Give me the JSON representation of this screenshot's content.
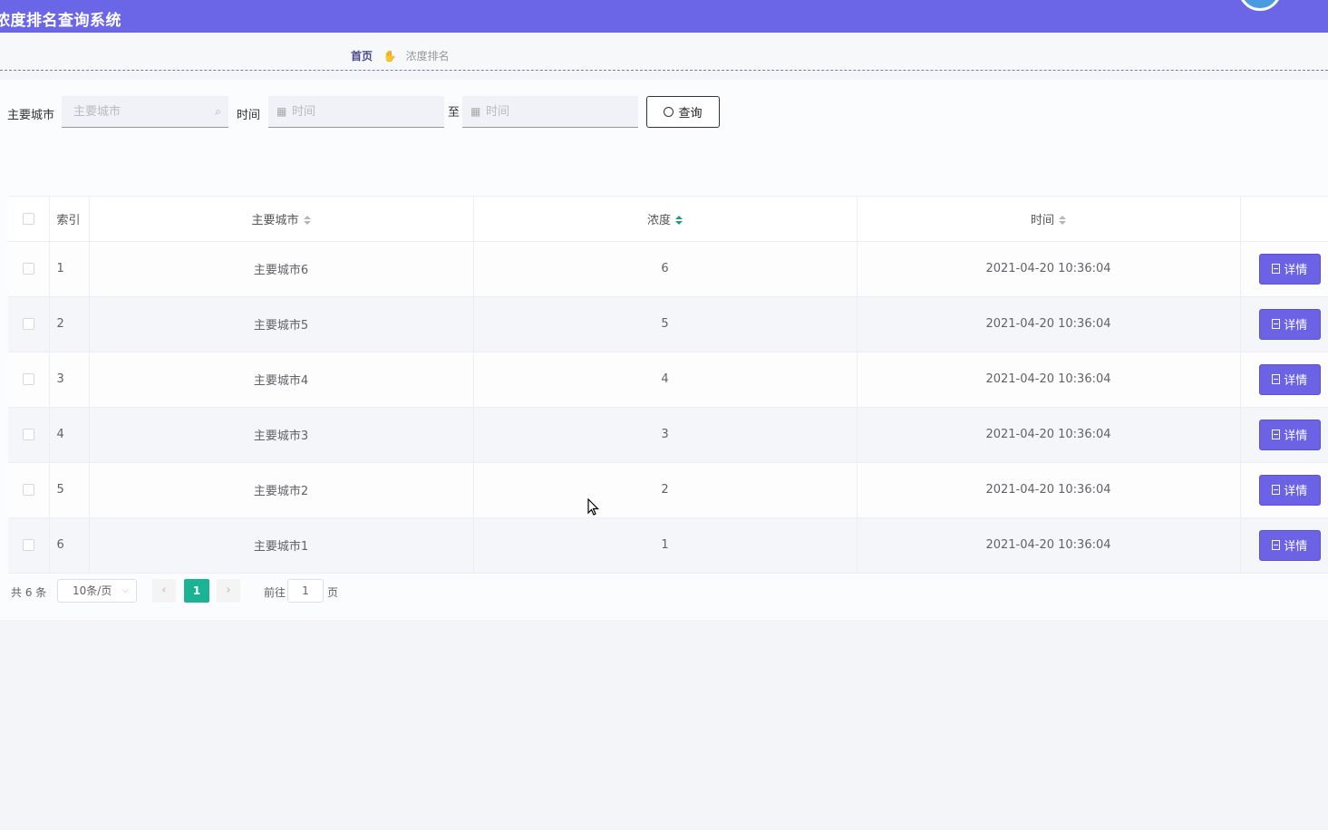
{
  "header": {
    "title": "浓度排名查询系统"
  },
  "breadcrumb": {
    "home": "首页",
    "separator_icon": "hand-pointer-icon",
    "current": "浓度排名"
  },
  "search": {
    "city_label": "主要城市",
    "city_placeholder": "主要城市",
    "time_label": "时间",
    "start_placeholder": "时间",
    "range_sep": "至",
    "end_placeholder": "时间",
    "query_label": "查询"
  },
  "table": {
    "columns": {
      "index": "索引",
      "city": "主要城市",
      "concentration": "浓度",
      "time": "时间"
    },
    "detail_label": "详情",
    "rows": [
      {
        "index": "1",
        "city": "主要城市6",
        "concentration": "6",
        "time": "2021-04-20 10:36:04"
      },
      {
        "index": "2",
        "city": "主要城市5",
        "concentration": "5",
        "time": "2021-04-20 10:36:04"
      },
      {
        "index": "3",
        "city": "主要城市4",
        "concentration": "4",
        "time": "2021-04-20 10:36:04"
      },
      {
        "index": "4",
        "city": "主要城市3",
        "concentration": "3",
        "time": "2021-04-20 10:36:04"
      },
      {
        "index": "5",
        "city": "主要城市2",
        "concentration": "2",
        "time": "2021-04-20 10:36:04"
      },
      {
        "index": "6",
        "city": "主要城市1",
        "concentration": "1",
        "time": "2021-04-20 10:36:04"
      }
    ]
  },
  "pagination": {
    "total": "共 6 条",
    "page_size": "10条/页",
    "current_page": "1",
    "goto_label": "前往",
    "goto_value": "1",
    "page_suffix": "页"
  },
  "colors": {
    "header_bg": "#6b66e8",
    "detail_button": "#6b62e6",
    "active_page": "#1ab394"
  }
}
